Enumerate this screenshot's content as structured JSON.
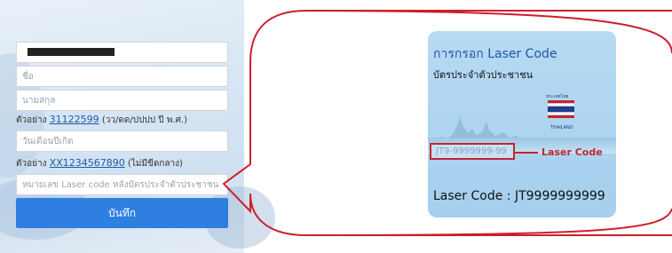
{
  "form": {
    "first_name_placeholder": "ชื่อ",
    "last_name_placeholder": "นามสกุล",
    "id_hint_prefix": "ตัวอย่าง",
    "id_hint_link": "31122599",
    "id_hint_suffix": "(วว/ดด/ปปปป ปี พ.ศ.)",
    "birthdate_placeholder": "วันเดือนปีเกิด",
    "laser_hint_prefix": "ตัวอย่าง",
    "laser_hint_link": "XX1234567890",
    "laser_hint_suffix": "(ไม่มีขีดกลาง)",
    "laser_placeholder": "หมายเลข Laser code หลังบัตรประจำตัวประชาชน",
    "save_label": "บันทึก"
  },
  "card": {
    "title_line1": "การกรอก Laser Code",
    "title_line2": "บัตรประจำตัวประชาชน",
    "flag_label": "ประเทศไทย",
    "country": "THAILAND",
    "sample_code": "JT9-9999999-99",
    "laser_label": "Laser Code",
    "bottom_text": "Laser Code : JT9999999999"
  },
  "colors": {
    "accent": "#2f7fe0",
    "callout": "#cc1f2a"
  }
}
